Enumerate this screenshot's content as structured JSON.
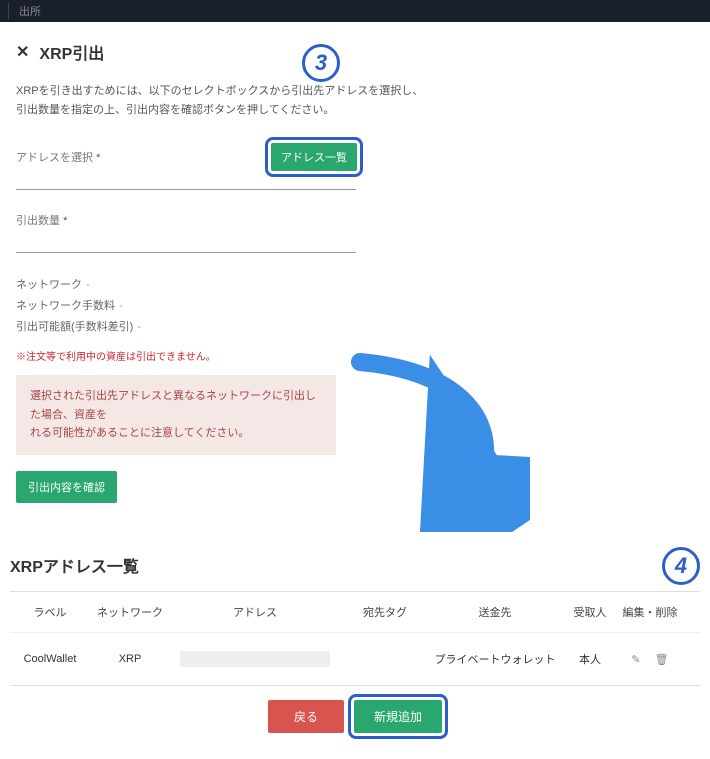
{
  "topbar": {
    "tab": "出所"
  },
  "main": {
    "title": "XRP引出",
    "desc_line1": "XRPを引き出すためには、以下のセレクトボックスから引出先アドレスを選択し、",
    "desc_line2": "引出数量を指定の上、引出内容を確認ボタンを押してください。",
    "field_address_label": "アドレスを選択",
    "field_qty_label": "引出数量",
    "required_mark": "*",
    "addr_list_btn": "アドレス一覧",
    "info": {
      "network": "ネットワーク",
      "fee": "ネットワーク手数料",
      "available": "引出可能額(手数料差引)",
      "dash": "-"
    },
    "note_red": "※注文等で利用中の資産は引出できません。",
    "warn_line1": "選択された引出先アドレスと異なるネットワークに引出した場合、資産を",
    "warn_line2": "れる可能性があることに注意してください。",
    "confirm_btn": "引出内容を確認"
  },
  "badges": {
    "three": "3",
    "four": "4"
  },
  "list": {
    "title": "XRPアドレス一覧",
    "headers": {
      "label": "ラベル",
      "network": "ネットワーク",
      "address": "アドレス",
      "tag": "宛先タグ",
      "dest": "送金先",
      "recipient": "受取人",
      "edit_del": "編集・削除"
    },
    "rows": [
      {
        "label": "CoolWallet",
        "network": "XRP",
        "address_masked": true,
        "tag": "",
        "dest": "プライベートウォレット",
        "recipient": "本人"
      }
    ],
    "btn_back": "戻る",
    "btn_add": "新規追加"
  }
}
